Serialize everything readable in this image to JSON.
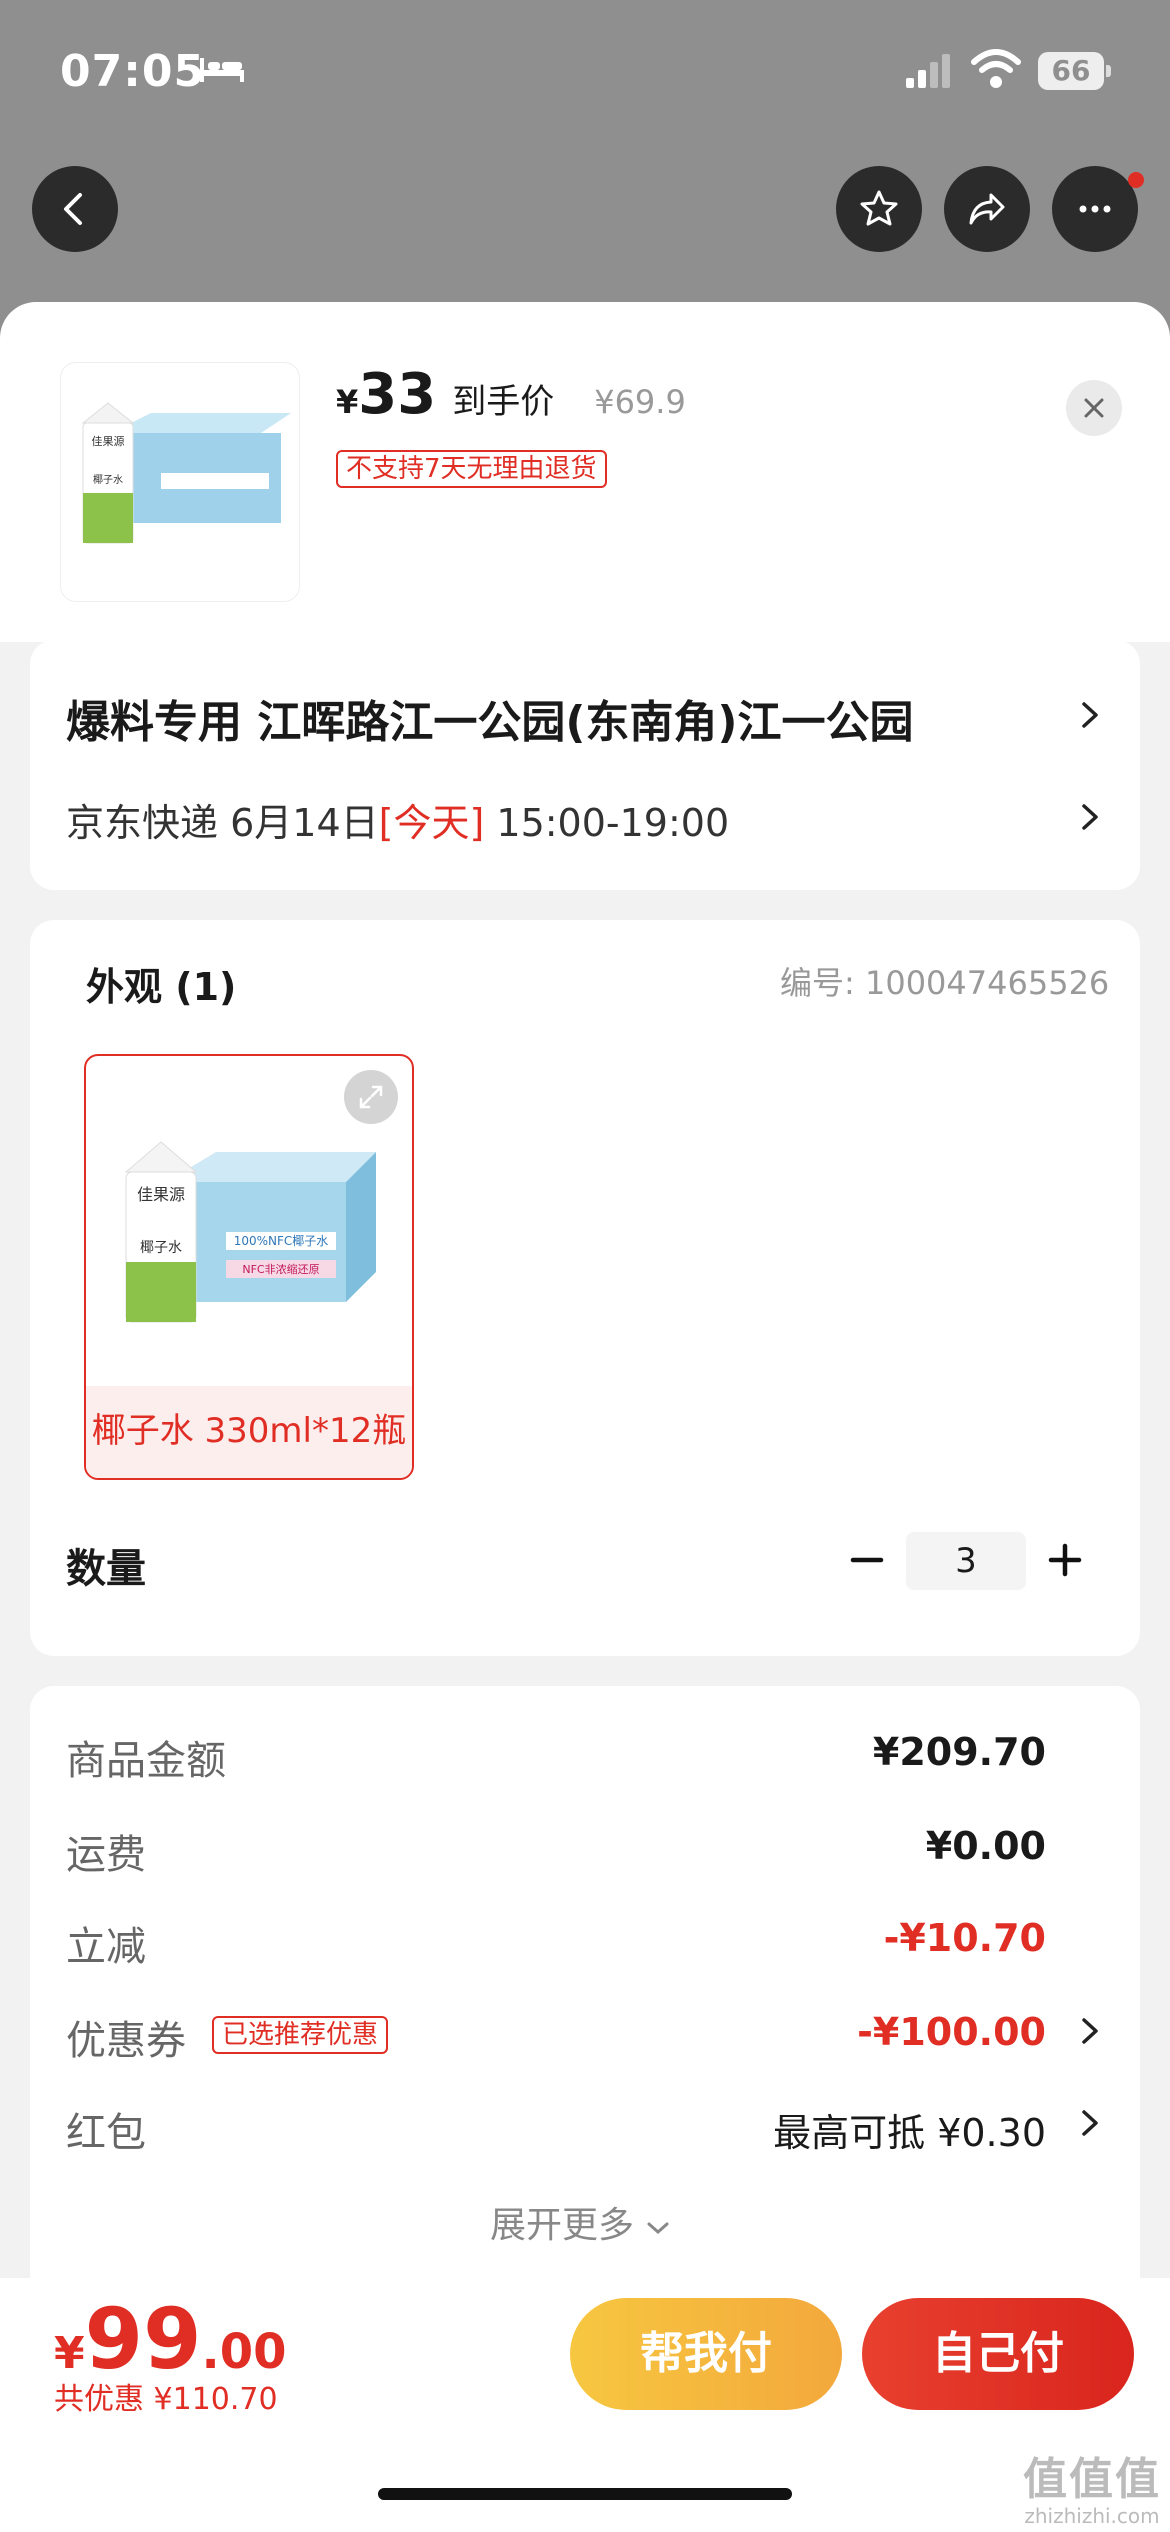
{
  "status_bar": {
    "time": "07:05",
    "battery": "66"
  },
  "header": {
    "price_symbol": "¥",
    "price": "33",
    "price_label": "到手价",
    "original_price": "¥69.9",
    "return_notice": "不支持7天无理由退货"
  },
  "product_image_text": {
    "brand": "佳果源",
    "label": "椰子水",
    "box_text": "100%NFC椰子水",
    "box_sub": "NFC非浓缩还原"
  },
  "address": {
    "line": "爆料专用  江晖路江一公园(东南角)江一公园",
    "carrier": "京东快递",
    "date": "6月14日",
    "today": "[今天]",
    "time_window": "15:00-19:00"
  },
  "spec": {
    "title": "外观 (1)",
    "sku_label": "编号:",
    "sku_number": "100047465526",
    "option_caption": "椰子水 330ml*12瓶"
  },
  "quantity": {
    "label": "数量",
    "value": "3"
  },
  "fees": [
    {
      "label": "商品金额",
      "value": "¥209.70",
      "color": "#1a1a1a"
    },
    {
      "label": "运费",
      "value": "¥0.00",
      "color": "#1a1a1a"
    },
    {
      "label": "立减",
      "value": "-¥10.70",
      "color": "#e02e24"
    },
    {
      "label": "优惠券",
      "value": "-¥100.00",
      "color": "#e02e24",
      "badge": "已选推荐优惠"
    },
    {
      "label": "红包",
      "value": "最高可抵 ¥0.30",
      "color": "#1a1a1a"
    }
  ],
  "more": "展开更多",
  "bottom": {
    "currency": "¥",
    "total_int": "99",
    "total_dec": ".00",
    "saving": "共优惠 ¥110.70",
    "help_pay": "帮我付",
    "self_pay": "自己付"
  },
  "watermark": {
    "mark": "值值值",
    "site": "zhizhizhi.com"
  },
  "colors": {
    "accent": "#e02e24",
    "help_btn": "#f5b83e",
    "overlay": "#8f8f8f"
  }
}
